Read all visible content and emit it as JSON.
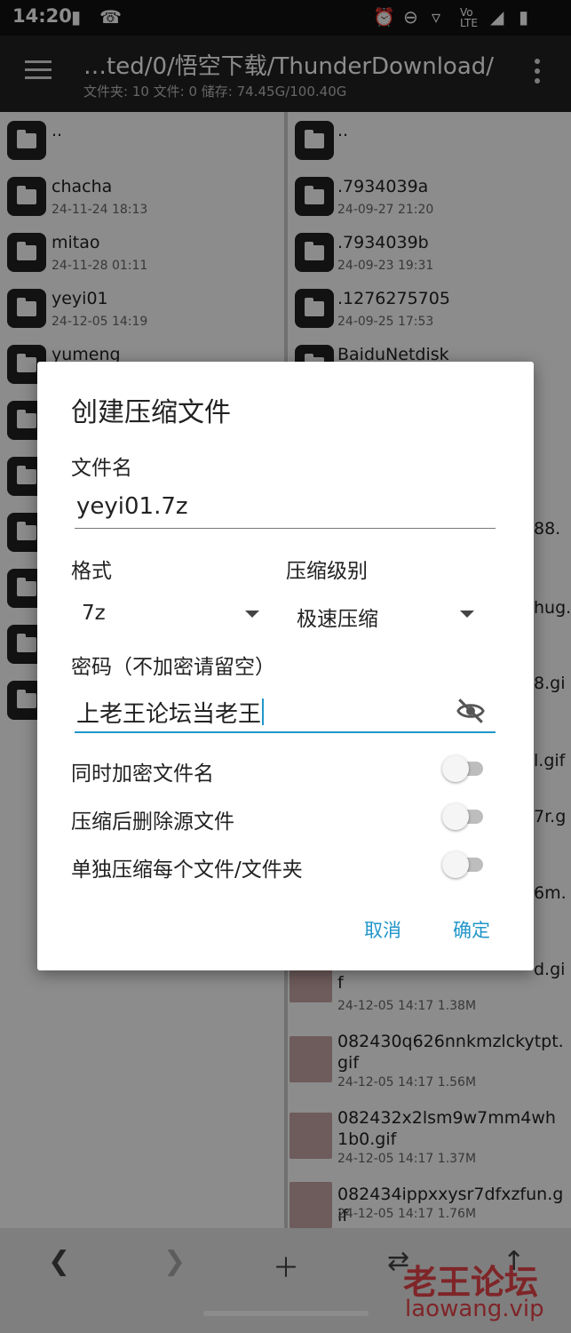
{
  "status_bar": {
    "time": "14:20",
    "icons": [
      "sim-icon",
      "missed-call-icon",
      "alarm-icon",
      "dnd-icon",
      "wifi-icon",
      "volte-icon",
      "signal-icon",
      "battery-icon"
    ]
  },
  "toolbar": {
    "path": "…ted/0/悟空下载/ThunderDownload/",
    "info": "文件夹: 10  文件: 0  储存: 74.45G/100.40G"
  },
  "left_pane": {
    "items": [
      {
        "name": "..",
        "date": ""
      },
      {
        "name": "chacha",
        "date": "24-11-24 18:13"
      },
      {
        "name": "mitao",
        "date": "24-11-28 01:11"
      },
      {
        "name": "yeyi01",
        "date": "24-12-05 14:19"
      },
      {
        "name": "yumeng",
        "date": ""
      }
    ]
  },
  "right_pane": {
    "folders": [
      {
        "name": "..",
        "date": ""
      },
      {
        "name": ".7934039a",
        "date": "24-09-27 21:20"
      },
      {
        "name": ".7934039b",
        "date": "24-09-23 19:31"
      },
      {
        "name": ".1276275705",
        "date": "24-09-25 17:53"
      },
      {
        "name": "BaiduNetdisk",
        "date": ""
      }
    ],
    "peeks": [
      "88.",
      "hug.",
      "8.gi",
      "l.gif",
      "7r.g",
      "6m.",
      "d.gi"
    ],
    "files": [
      {
        "name": "f",
        "meta": "24-12-05 14:17  1.38M"
      },
      {
        "name": "082430q626nnkmzlckytpt.gif",
        "meta": "24-12-05 14:17  1.56M"
      },
      {
        "name": "082432x2lsm9w7mm4wh1b0.gif",
        "meta": "24-12-05 14:17  1.37M"
      },
      {
        "name": "082434ippxxysr7dfxzfun.gif",
        "meta": "24-12-05 14:17  1.76M"
      }
    ]
  },
  "bottom_bar": {
    "icons": [
      "back-icon",
      "forward-icon",
      "add-icon",
      "swap-icon",
      "up-icon"
    ]
  },
  "watermark": {
    "cn": "老王论坛",
    "en": "laowang.vip"
  },
  "dialog": {
    "title": "创建压缩文件",
    "filename_label": "文件名",
    "filename_value": "yeyi01.7z",
    "format_label": "格式",
    "format_value": "7z",
    "level_label": "压缩级别",
    "level_value": "极速压缩",
    "password_label": "密码（不加密请留空）",
    "password_value": "上老王论坛当老王",
    "options": [
      {
        "label": "同时加密文件名",
        "on": false
      },
      {
        "label": "压缩后删除源文件",
        "on": false
      },
      {
        "label": "单独压缩每个文件/文件夹",
        "on": false
      }
    ],
    "cancel_label": "取消",
    "ok_label": "确定"
  },
  "colors": {
    "accent": "#2196c9",
    "toolbar_bg": "#222222",
    "watermark": "#e8444a"
  }
}
